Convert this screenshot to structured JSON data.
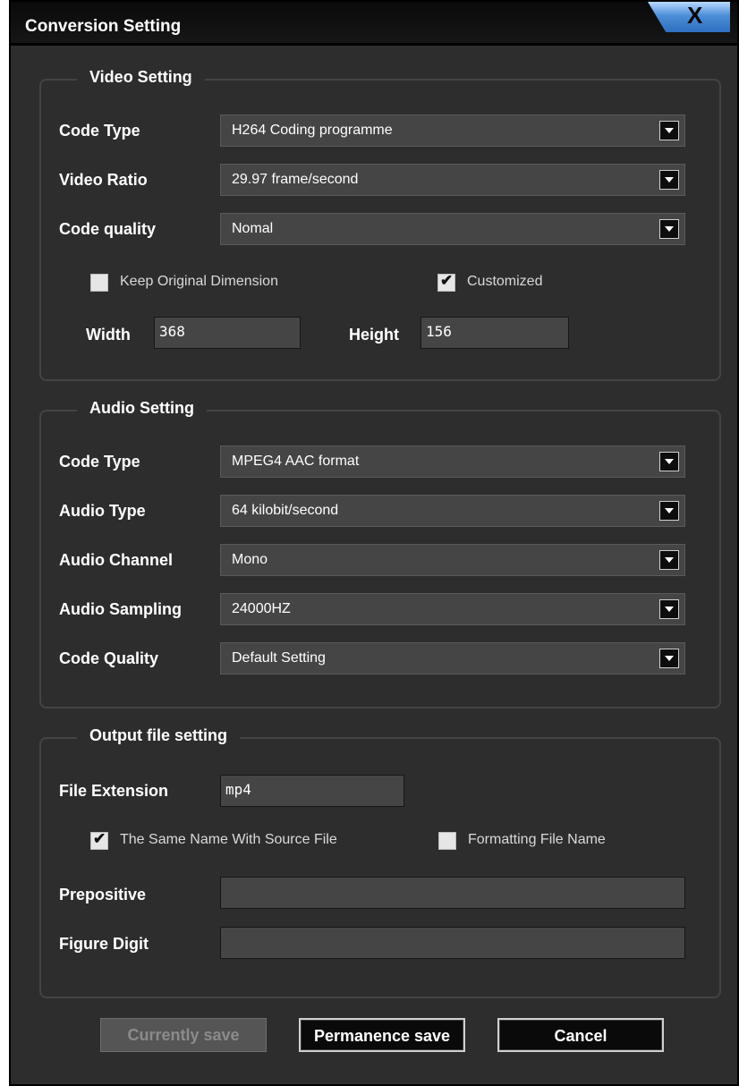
{
  "window": {
    "title": "Conversion Setting",
    "close_label": "X"
  },
  "video": {
    "legend": "Video Setting",
    "code_type": {
      "label": "Code Type",
      "value": "H264 Coding programme"
    },
    "video_ratio": {
      "label": "Video Ratio",
      "value": "29.97 frame/second"
    },
    "code_quality": {
      "label": "Code quality",
      "value": "Nomal"
    },
    "keep_original": {
      "label": "Keep Original Dimension",
      "checked": false
    },
    "customized": {
      "label": "Customized",
      "checked": true
    },
    "width": {
      "label": "Width",
      "value": "368"
    },
    "height": {
      "label": "Height",
      "value": "156"
    }
  },
  "audio": {
    "legend": "Audio Setting",
    "code_type": {
      "label": "Code Type",
      "value": "MPEG4 AAC format"
    },
    "audio_type": {
      "label": "Audio Type",
      "value": "64 kilobit/second"
    },
    "audio_channel": {
      "label": "Audio Channel",
      "value": "Mono"
    },
    "audio_sampling": {
      "label": "Audio Sampling",
      "value": "24000HZ"
    },
    "code_quality": {
      "label": "Code Quality",
      "value": "Default Setting"
    }
  },
  "output": {
    "legend": "Output file setting",
    "file_extension": {
      "label": "File Extension",
      "value": "mp4"
    },
    "same_name": {
      "label": "The Same Name With Source File",
      "checked": true
    },
    "formatting": {
      "label": "Formatting File Name",
      "checked": false
    },
    "prepositive": {
      "label": "Prepositive",
      "value": ""
    },
    "figure_digit": {
      "label": "Figure Digit",
      "value": ""
    }
  },
  "buttons": {
    "currently_save": "Currently save",
    "permanence_save": "Permanence save",
    "cancel": "Cancel"
  },
  "marks": {
    "check": "✔"
  }
}
